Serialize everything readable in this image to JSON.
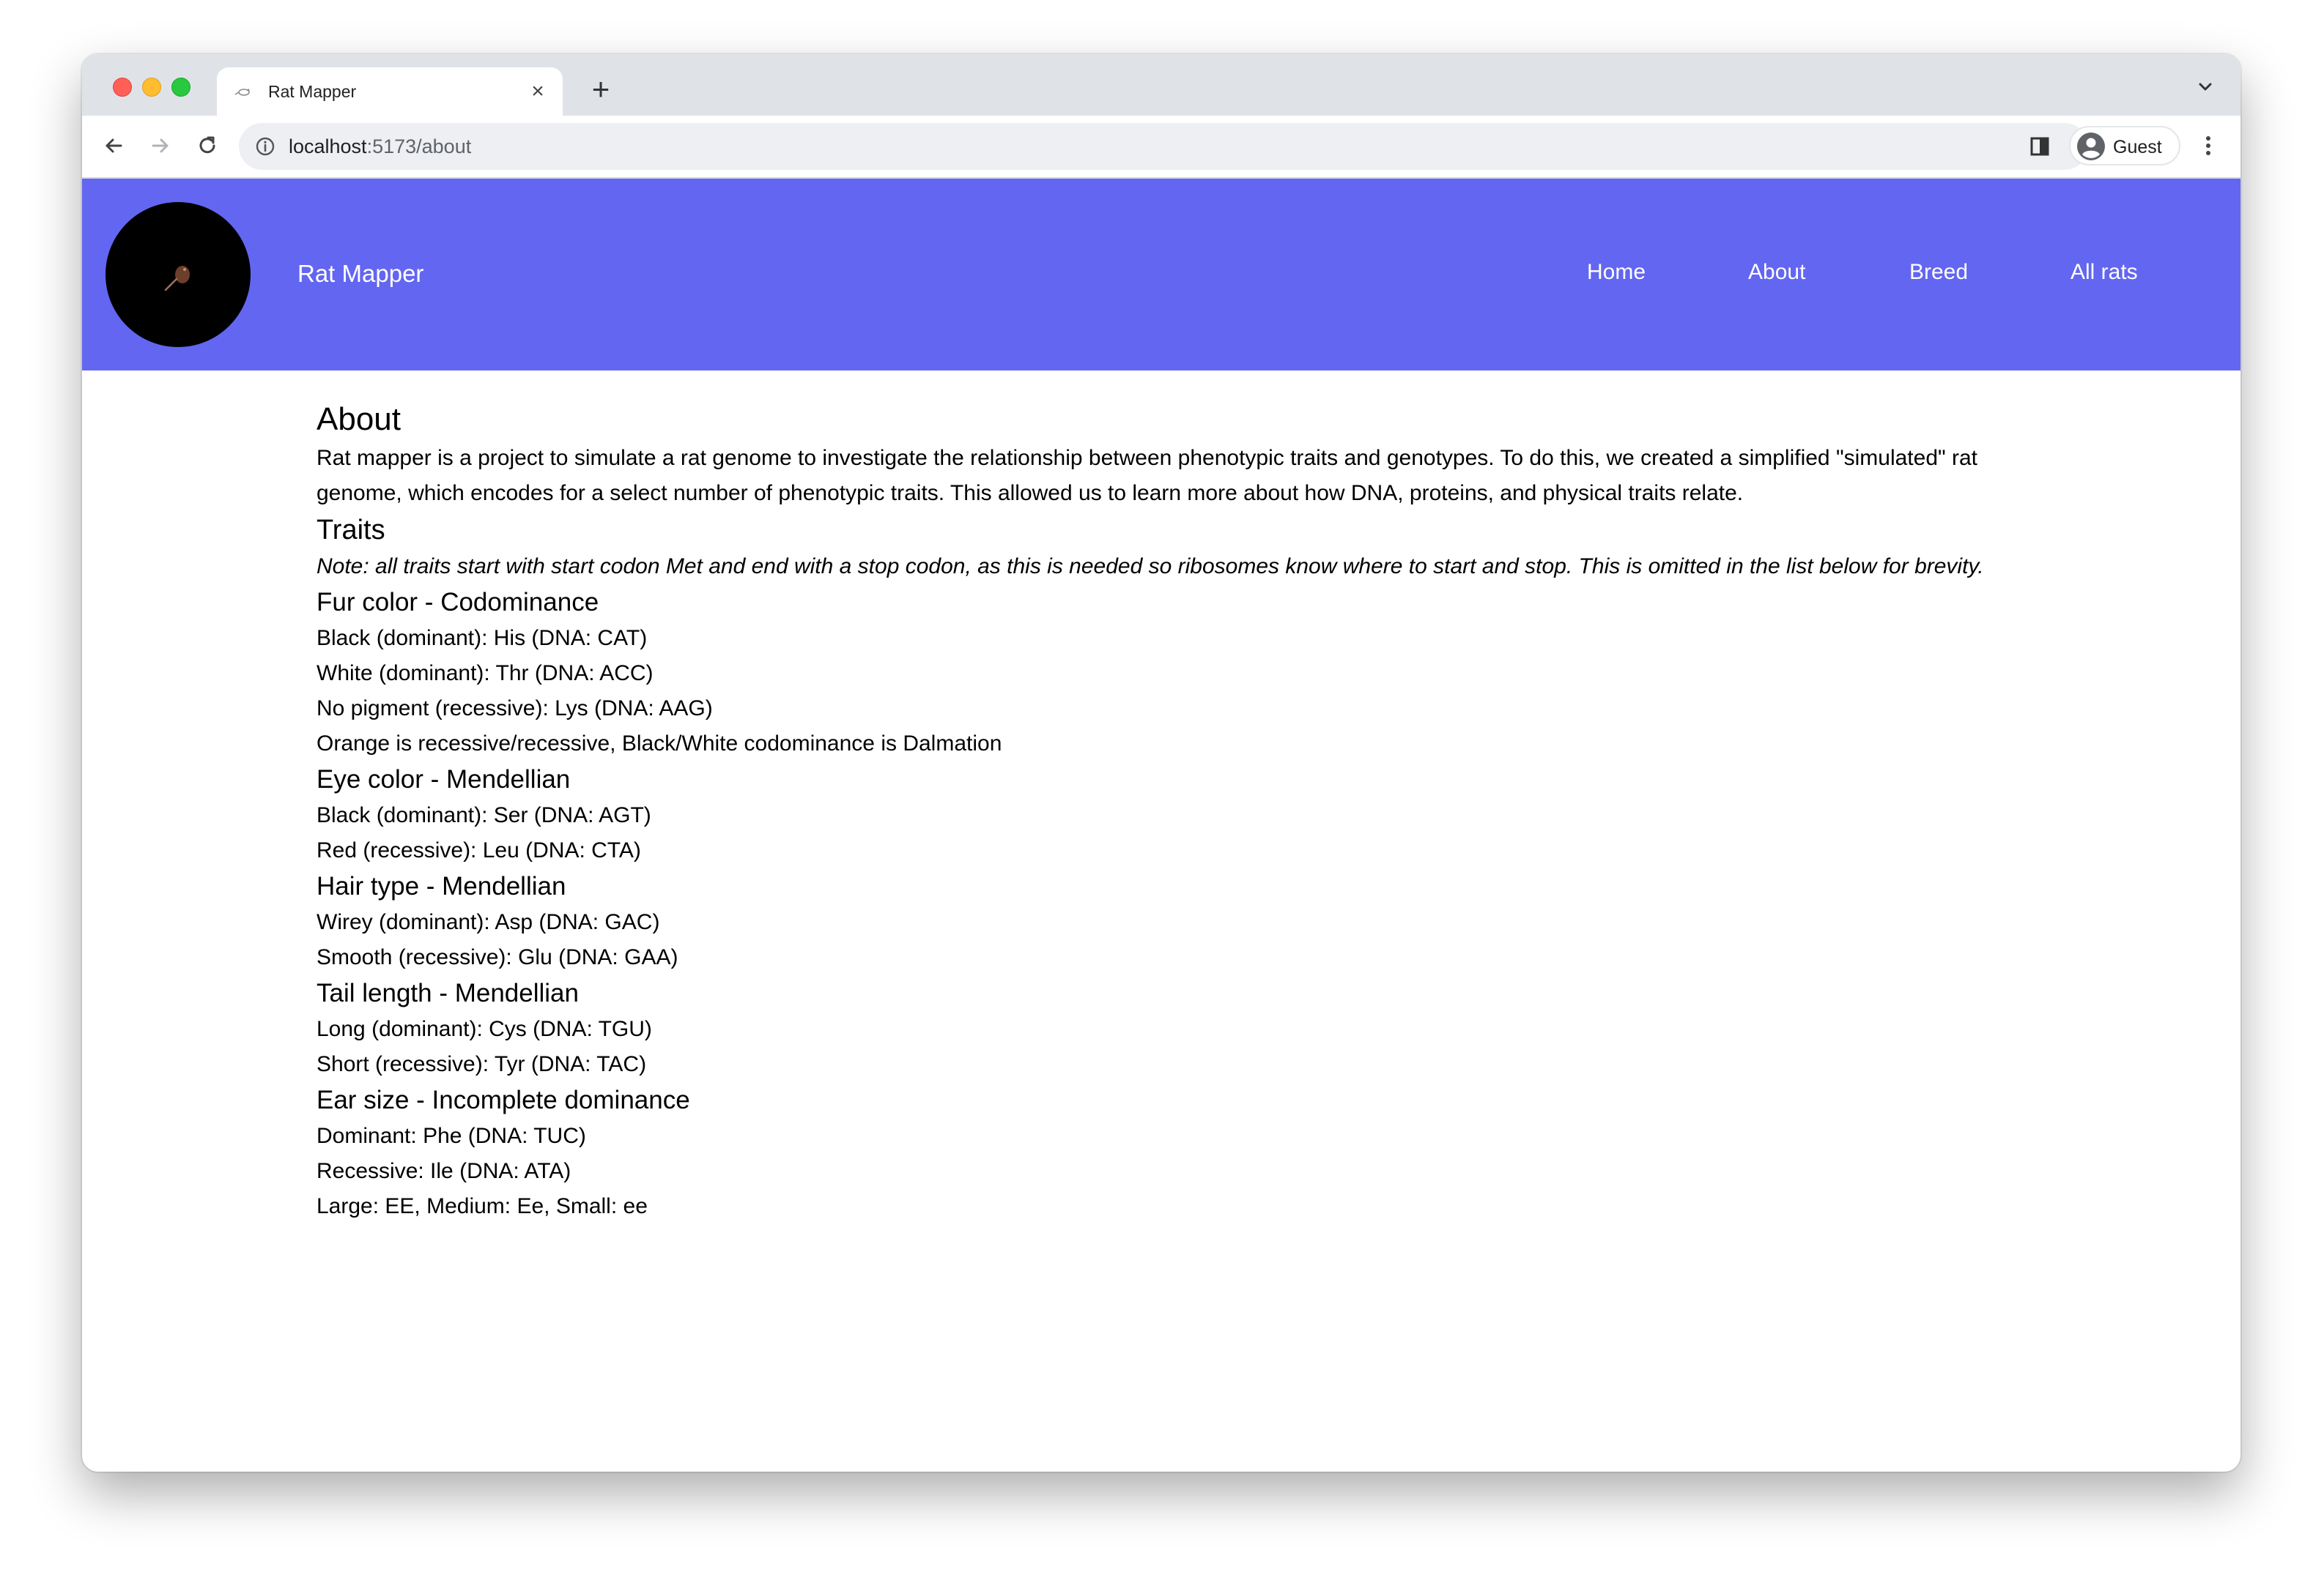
{
  "browser": {
    "tab_title": "Rat Mapper",
    "new_tab_symbol": "+",
    "close_symbol": "×",
    "url_host": "localhost",
    "url_path": ":5173/about",
    "profile_label": "Guest"
  },
  "header": {
    "brand": "Rat Mapper",
    "nav": [
      "Home",
      "About",
      "Breed",
      "All rats"
    ],
    "color": "#6366f1"
  },
  "about": {
    "title": "About",
    "intro": "Rat mapper is a project to simulate a rat genome to investigate the relationship between phenotypic traits and genotypes. To do this, we created a simplified \"simulated\" rat genome, which encodes for a select number of phenotypic traits. This allowed us to learn more about how DNA, proteins, and physical traits relate.",
    "traits_title": "Traits",
    "note": "Note: all traits start with start codon Met and end with a stop codon, as this is needed so ribosomes know where to start and stop. This is omitted in the list below for brevity.",
    "traits": [
      {
        "title": "Fur color - Codominance",
        "lines": [
          "Black (dominant): His (DNA: CAT)",
          "White (dominant): Thr (DNA: ACC)",
          "No pigment (recessive): Lys (DNA: AAG)",
          "Orange is recessive/recessive, Black/White codominance is Dalmation"
        ]
      },
      {
        "title": "Eye color - Mendellian",
        "lines": [
          "Black (dominant): Ser (DNA: AGT)",
          "Red (recessive): Leu (DNA: CTA)"
        ]
      },
      {
        "title": "Hair type - Mendellian",
        "lines": [
          "Wirey (dominant): Asp (DNA: GAC)",
          "Smooth (recessive): Glu (DNA: GAA)"
        ]
      },
      {
        "title": "Tail length - Mendellian",
        "lines": [
          "Long (dominant): Cys (DNA: TGU)",
          "Short (recessive): Tyr (DNA: TAC)"
        ]
      },
      {
        "title": "Ear size - Incomplete dominance",
        "lines": [
          "Dominant: Phe (DNA: TUC)",
          "Recessive: Ile (DNA: ATA)",
          "Large: EE, Medium: Ee, Small: ee"
        ]
      }
    ]
  }
}
